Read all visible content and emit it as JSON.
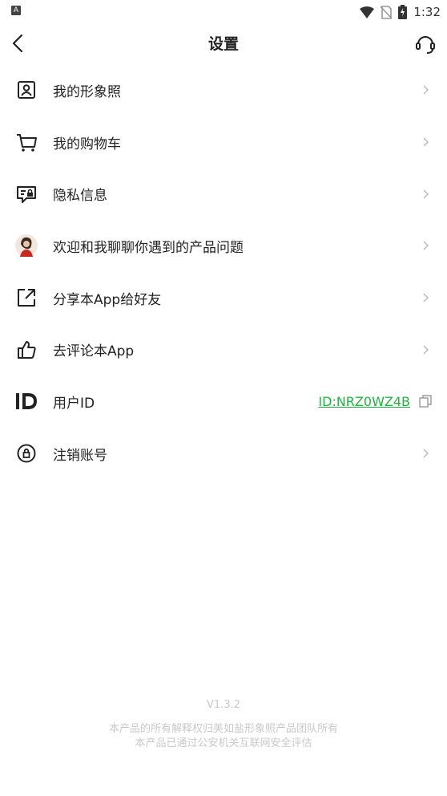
{
  "status_bar": {
    "time": "1:32",
    "left_icon": "A",
    "icons": [
      "notification-app-icon",
      "wifi-icon",
      "no-sim-icon",
      "battery-charging-icon"
    ]
  },
  "nav": {
    "title": "设置",
    "back_icon": "chevron-left-icon",
    "support_icon": "headset-icon"
  },
  "settings": [
    {
      "label": "我的形象照",
      "icon": "portrait-frame-icon"
    },
    {
      "label": "我的购物车",
      "icon": "shopping-cart-icon"
    },
    {
      "label": "隐私信息",
      "icon": "privacy-card-icon"
    },
    {
      "label": "欢迎和我聊聊你遇到的产品问题",
      "icon": "avatar-photo"
    },
    {
      "label": "分享本App给好友",
      "icon": "share-external-icon"
    },
    {
      "label": "去评论本App",
      "icon": "thumbs-up-icon"
    },
    {
      "label": "用户ID",
      "icon": "id-icon",
      "value": "ID:NRZ0WZ4B",
      "value_color": "#19b83a"
    },
    {
      "label": "注销账号",
      "icon": "account-lock-icon"
    }
  ],
  "footer": {
    "version": "V1.3.2",
    "copyright_line1": "本产品的所有解释权归美如盐形象照产品团队所有",
    "copyright_line2": "本产品已通过公安机关互联网安全评估"
  },
  "colors": {
    "accent_green": "#19b83a",
    "footer_text": "#c9c9c9",
    "chevron": "#bbbbbb"
  }
}
